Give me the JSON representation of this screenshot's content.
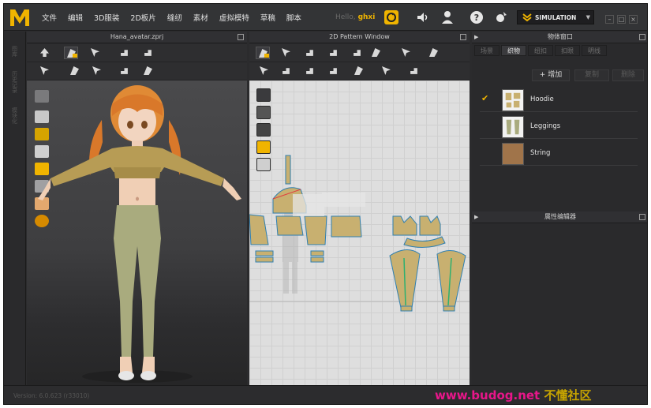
{
  "app": {
    "brand": "MD"
  },
  "menu": [
    "文件",
    "编辑",
    "3D服装",
    "2D板片",
    "缝纫",
    "素材",
    "虚拟模特",
    "草稿",
    "脚本"
  ],
  "user": {
    "greeting": "Hello,",
    "name": "ghxi"
  },
  "simulation": {
    "label": "SIMULATION"
  },
  "panels": {
    "view3d": {
      "title": "Hana_avatar.zprj"
    },
    "view2d": {
      "title": "2D Pattern Window"
    },
    "object_browser": {
      "title": "物体窗口",
      "tabs": [
        "场景",
        "织物",
        "纽扣",
        "扣眼",
        "明线"
      ],
      "active_tab": 1
    },
    "property_editor": {
      "title": "属性编辑器"
    }
  },
  "object_browser": {
    "add_label": "+ 增加",
    "copy_label": "复制",
    "delete_label": "删除",
    "fabrics": [
      {
        "name": "Hoodie",
        "selected": true
      },
      {
        "name": "Leggings",
        "selected": false
      },
      {
        "name": "String",
        "selected": false
      }
    ]
  },
  "status": {
    "version": "Version: 6.0.623 (r33010)"
  },
  "watermark": {
    "url": "www.budog.net",
    "cn": "不懂社区"
  },
  "colors": {
    "accent": "#f0b400",
    "garment": "#c8b070",
    "legging": "#a9ab7e",
    "hair": "#d9782a"
  }
}
